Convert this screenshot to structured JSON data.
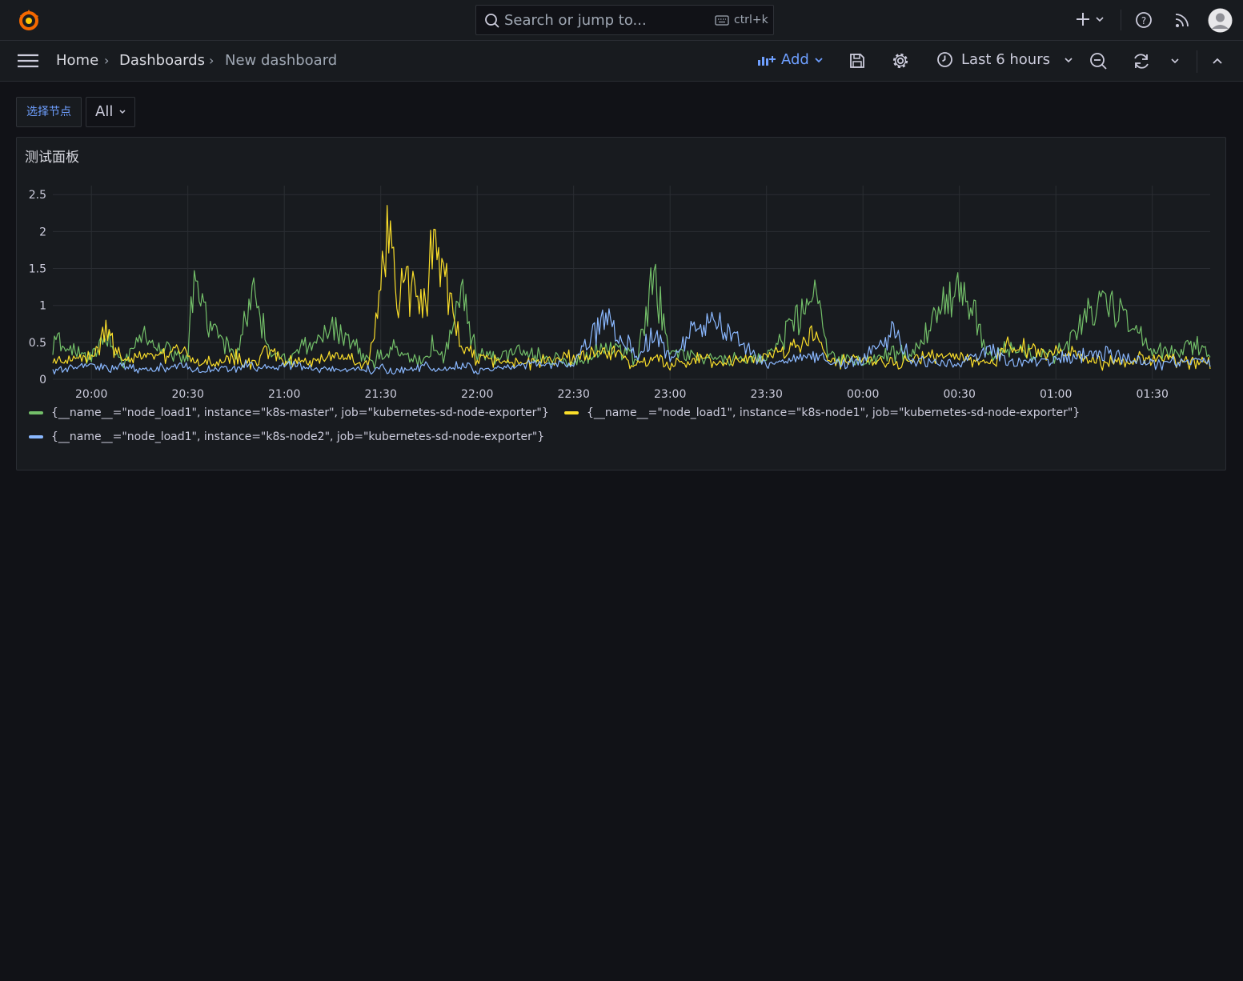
{
  "topbar": {
    "search_placeholder": "Search or jump to...",
    "shortcut": "ctrl+k",
    "icons": [
      "grafana-logo-icon",
      "search-icon",
      "keyboard-icon",
      "plus-icon",
      "chevron-down-icon",
      "help-icon",
      "rss-icon",
      "avatar"
    ]
  },
  "breadcrumb": {
    "home": "Home",
    "dashboards": "Dashboards",
    "current": "New dashboard",
    "separator": "›"
  },
  "toolbar": {
    "add_label": "Add",
    "time_range": "Last 6 hours"
  },
  "variables": {
    "label": "选择节点",
    "value": "All"
  },
  "panel": {
    "title": "测试面板"
  },
  "colors": {
    "green": "#73bf69",
    "yellow": "#fade2a",
    "blue": "#8ab8ff",
    "accent": "#6e9fff",
    "logo": "#f46800"
  },
  "chart_data": {
    "type": "line",
    "title": "测试面板",
    "xlabel": "",
    "ylabel": "",
    "x_ticks": [
      "20:00",
      "20:30",
      "21:00",
      "21:30",
      "22:00",
      "22:30",
      "23:00",
      "23:30",
      "00:00",
      "00:30",
      "01:00",
      "01:30"
    ],
    "y_ticks": [
      "0",
      "0.5",
      "1",
      "1.5",
      "2",
      "2.5"
    ],
    "ylim": [
      0,
      2.6
    ],
    "grid": true,
    "legend_placement": "bottom",
    "x": [
      "19:48",
      "20:00",
      "20:05",
      "20:10",
      "20:15",
      "20:30",
      "20:31",
      "20:45",
      "20:50",
      "20:56",
      "21:00",
      "21:15",
      "21:26",
      "21:28",
      "21:30",
      "21:32",
      "21:35",
      "21:40",
      "21:44",
      "21:46",
      "21:48",
      "21:50",
      "21:55",
      "22:00",
      "22:15",
      "22:30",
      "22:40",
      "22:50",
      "22:55",
      "23:00",
      "23:10",
      "23:15",
      "23:30",
      "23:45",
      "23:50",
      "00:00",
      "00:10",
      "00:15",
      "00:30",
      "00:40",
      "00:45",
      "01:00",
      "01:15",
      "01:30",
      "01:45",
      "01:48"
    ],
    "series": [
      {
        "name": "{__name__=\"node_load1\", instance=\"k8s-master\", job=\"kubernetes-sd-node-exporter\"}",
        "color": "#73bf69",
        "values": [
          0.6,
          0.3,
          0.7,
          0.2,
          0.75,
          0.25,
          1.45,
          0.3,
          1.45,
          0.4,
          0.25,
          0.8,
          0.3,
          0.2,
          0.4,
          0.3,
          0.5,
          0.3,
          0.2,
          0.6,
          0.3,
          0.35,
          1.5,
          0.3,
          0.4,
          0.2,
          0.5,
          0.3,
          1.7,
          0.4,
          0.3,
          0.3,
          0.3,
          1.4,
          0.3,
          0.2,
          0.4,
          0.3,
          1.7,
          0.3,
          0.5,
          0.3,
          1.4,
          0.4,
          0.5,
          0.25
        ]
      },
      {
        "name": "{__name__=\"node_load1\", instance=\"k8s-node1\", job=\"kubernetes-sd-node-exporter\"}",
        "color": "#fade2a",
        "values": [
          0.2,
          0.3,
          0.75,
          0.2,
          0.3,
          0.4,
          0.2,
          0.3,
          0.2,
          0.5,
          0.2,
          0.3,
          0.2,
          0.7,
          1.5,
          2.35,
          1.5,
          1.4,
          1.1,
          2.4,
          1.8,
          1.6,
          0.5,
          0.3,
          0.2,
          0.3,
          0.4,
          0.2,
          0.3,
          0.2,
          0.3,
          0.2,
          0.3,
          0.7,
          0.2,
          0.3,
          0.2,
          0.3,
          0.3,
          0.2,
          0.5,
          0.4,
          0.2,
          0.3,
          0.2,
          0.2
        ]
      },
      {
        "name": "{__name__=\"node_load1\", instance=\"k8s-node2\", job=\"kubernetes-sd-node-exporter\"}",
        "color": "#8ab8ff",
        "values": [
          0.1,
          0.2,
          0.15,
          0.2,
          0.1,
          0.2,
          0.1,
          0.15,
          0.2,
          0.1,
          0.2,
          0.1,
          0.15,
          0.1,
          0.2,
          0.1,
          0.1,
          0.15,
          0.2,
          0.1,
          0.15,
          0.1,
          0.2,
          0.1,
          0.2,
          0.2,
          1.05,
          0.3,
          0.8,
          0.3,
          0.95,
          0.9,
          0.2,
          0.4,
          0.2,
          0.3,
          0.8,
          0.3,
          0.2,
          0.5,
          0.2,
          0.3,
          0.4,
          0.2,
          0.3,
          0.2
        ]
      }
    ]
  }
}
